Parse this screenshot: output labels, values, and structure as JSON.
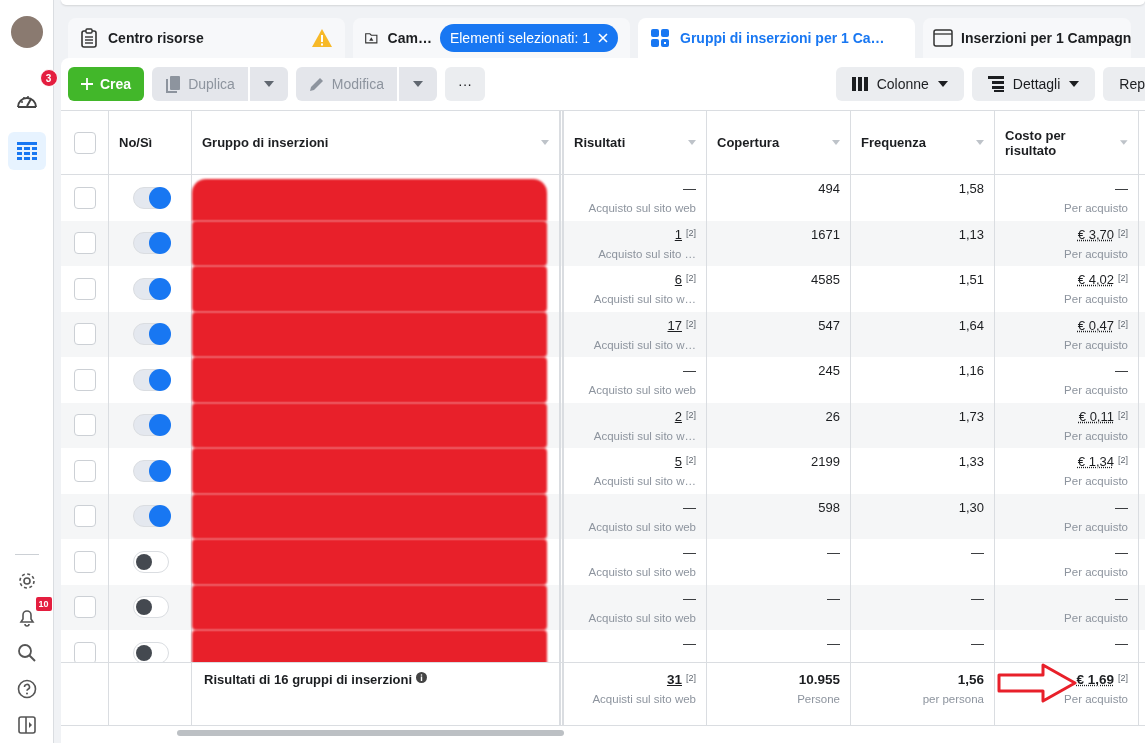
{
  "sidebar": {
    "items": [
      {
        "kind": "avatar"
      },
      {
        "kind": "gauge",
        "selected": false,
        "badge": "3"
      },
      {
        "kind": "table",
        "selected": true
      }
    ],
    "bottom_items": [
      {
        "kind": "gear"
      },
      {
        "kind": "bell",
        "badge": "10"
      },
      {
        "kind": "search"
      },
      {
        "kind": "help"
      },
      {
        "kind": "panel"
      }
    ]
  },
  "tabs": [
    {
      "kind": "clipboard",
      "label": "Centro risorse",
      "selected": false,
      "warning": true
    },
    {
      "kind": "folder",
      "label": "Cam…",
      "selected": false,
      "chip": "Elementi selezionati: 1"
    },
    {
      "kind": "grid",
      "label": "Gruppi di inserzioni per 1 Ca…",
      "selected": true
    },
    {
      "kind": "window",
      "label": "Inserzioni per 1 Campagn",
      "selected": false
    }
  ],
  "toolbar": {
    "left": [
      {
        "kind": "plus",
        "label": "Crea",
        "disabled": false,
        "caret": false
      },
      {
        "kind": "copy",
        "label": "Duplica",
        "disabled": true,
        "caret": true
      },
      {
        "kind": "pencil",
        "label": "Modifica",
        "disabled": true,
        "caret": true
      },
      {
        "kind": "more",
        "label": "···",
        "disabled": false,
        "caret": false
      }
    ],
    "right": [
      {
        "kind": "columns",
        "label": "Colonne",
        "caret": true
      },
      {
        "kind": "details",
        "label": "Dettagli",
        "caret": true
      },
      {
        "kind": "none",
        "label": "Rep",
        "caret": false
      }
    ]
  },
  "table": {
    "all_checked": false,
    "columns": [
      "No/Sì",
      "Gruppo di inserzioni",
      "Risultati",
      "Copertura",
      "Frequenza",
      "Costo per risultato"
    ],
    "rows": [
      {
        "checked": false,
        "on": true,
        "results": {
          "value": "—",
          "sub": "Acquisto sul sito web"
        },
        "reach": "494",
        "frequency": "1,58",
        "cost": {
          "value": "—",
          "sub": "Per acquisto"
        }
      },
      {
        "checked": false,
        "on": true,
        "results": {
          "value": "1",
          "note": "[2]",
          "sub": "Acquisto sul sito …"
        },
        "reach": "1671",
        "frequency": "1,13",
        "cost": {
          "value": "€ 3,70",
          "note": "[2]",
          "sub": "Per acquisto"
        }
      },
      {
        "checked": false,
        "on": true,
        "results": {
          "value": "6",
          "note": "[2]",
          "sub": "Acquisti sul sito w…"
        },
        "reach": "4585",
        "frequency": "1,51",
        "cost": {
          "value": "€ 4,02",
          "note": "[2]",
          "sub": "Per acquisto"
        }
      },
      {
        "checked": false,
        "on": true,
        "results": {
          "value": "17",
          "note": "[2]",
          "sub": "Acquisti sul sito w…"
        },
        "reach": "547",
        "frequency": "1,64",
        "cost": {
          "value": "€ 0,47",
          "note": "[2]",
          "sub": "Per acquisto"
        }
      },
      {
        "checked": false,
        "on": true,
        "results": {
          "value": "—",
          "sub": "Acquisto sul sito web"
        },
        "reach": "245",
        "frequency": "1,16",
        "cost": {
          "value": "—",
          "sub": "Per acquisto"
        }
      },
      {
        "checked": false,
        "on": true,
        "results": {
          "value": "2",
          "note": "[2]",
          "sub": "Acquisti sul sito w…"
        },
        "reach": "26",
        "frequency": "1,73",
        "cost": {
          "value": "€ 0,11",
          "note": "[2]",
          "sub": "Per acquisto"
        }
      },
      {
        "checked": false,
        "on": true,
        "results": {
          "value": "5",
          "note": "[2]",
          "sub": "Acquisti sul sito w…"
        },
        "reach": "2199",
        "frequency": "1,33",
        "cost": {
          "value": "€ 1,34",
          "note": "[2]",
          "sub": "Per acquisto"
        }
      },
      {
        "checked": false,
        "on": true,
        "results": {
          "value": "—",
          "sub": "Acquisto sul sito web"
        },
        "reach": "598",
        "frequency": "1,30",
        "cost": {
          "value": "—",
          "sub": "Per acquisto"
        }
      },
      {
        "checked": false,
        "on": false,
        "results": {
          "value": "—",
          "sub": "Acquisto sul sito web"
        },
        "reach": "—",
        "frequency": "—",
        "cost": {
          "value": "—",
          "sub": "Per acquisto"
        }
      },
      {
        "checked": false,
        "on": false,
        "results": {
          "value": "—",
          "sub": "Acquisto sul sito web"
        },
        "reach": "—",
        "frequency": "—",
        "cost": {
          "value": "—",
          "sub": "Per acquisto"
        }
      },
      {
        "checked": false,
        "on": false,
        "results": {
          "value": "—"
        },
        "reach": "—",
        "frequency": "—",
        "cost": {
          "value": "—"
        }
      }
    ],
    "footer": {
      "label": "Risultati di 16 gruppi di inserzioni",
      "results": {
        "value": "31",
        "note": "[2]",
        "sub": "Acquisti sul sito web"
      },
      "reach": {
        "value": "10.955",
        "sub": "Persone"
      },
      "frequency": {
        "value": "1,56",
        "sub": "per persona"
      },
      "cost": {
        "value": "€ 1,69",
        "note": "[2]",
        "sub": "Per acquisto"
      },
      "arrow_annotation": true
    }
  }
}
